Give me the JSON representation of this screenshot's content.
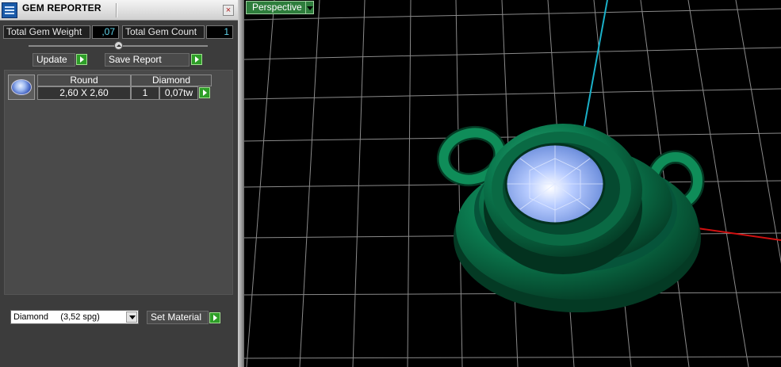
{
  "window": {
    "title": "GEM REPORTER",
    "close_glyph": "×"
  },
  "summary": {
    "weight_label": "Total Gem Weight",
    "weight_value": ",07",
    "count_label": "Total Gem Count",
    "count_value": "1"
  },
  "actions": {
    "update_label": "Update",
    "save_report_label": "Save Report"
  },
  "table": {
    "headers": [
      "Round",
      "Diamond"
    ],
    "rows": [
      {
        "size": "2,60 X 2,60",
        "count": "1",
        "weight": "0,07tw"
      }
    ]
  },
  "material": {
    "selected": "Diamond     (3,52 spg)",
    "set_label": "Set Material"
  },
  "viewport": {
    "view_label": "Perspective"
  },
  "colors": {
    "panel_bg": "#3c3c3c",
    "value_text": "#5fd3ea",
    "go_button": "#2e9e28",
    "model_metal": "#0b7a4f",
    "gem": "#8fb0f0",
    "axis_z": "#1ab0c8",
    "axis_x": "#d01010",
    "grid": "#8a8a8a"
  },
  "icons": [
    "gem-reporter-app-icon",
    "close-icon",
    "slider-collapse-icon",
    "play-arrow-icon",
    "dropdown-arrow-icon",
    "gem-thumbnail-icon"
  ]
}
